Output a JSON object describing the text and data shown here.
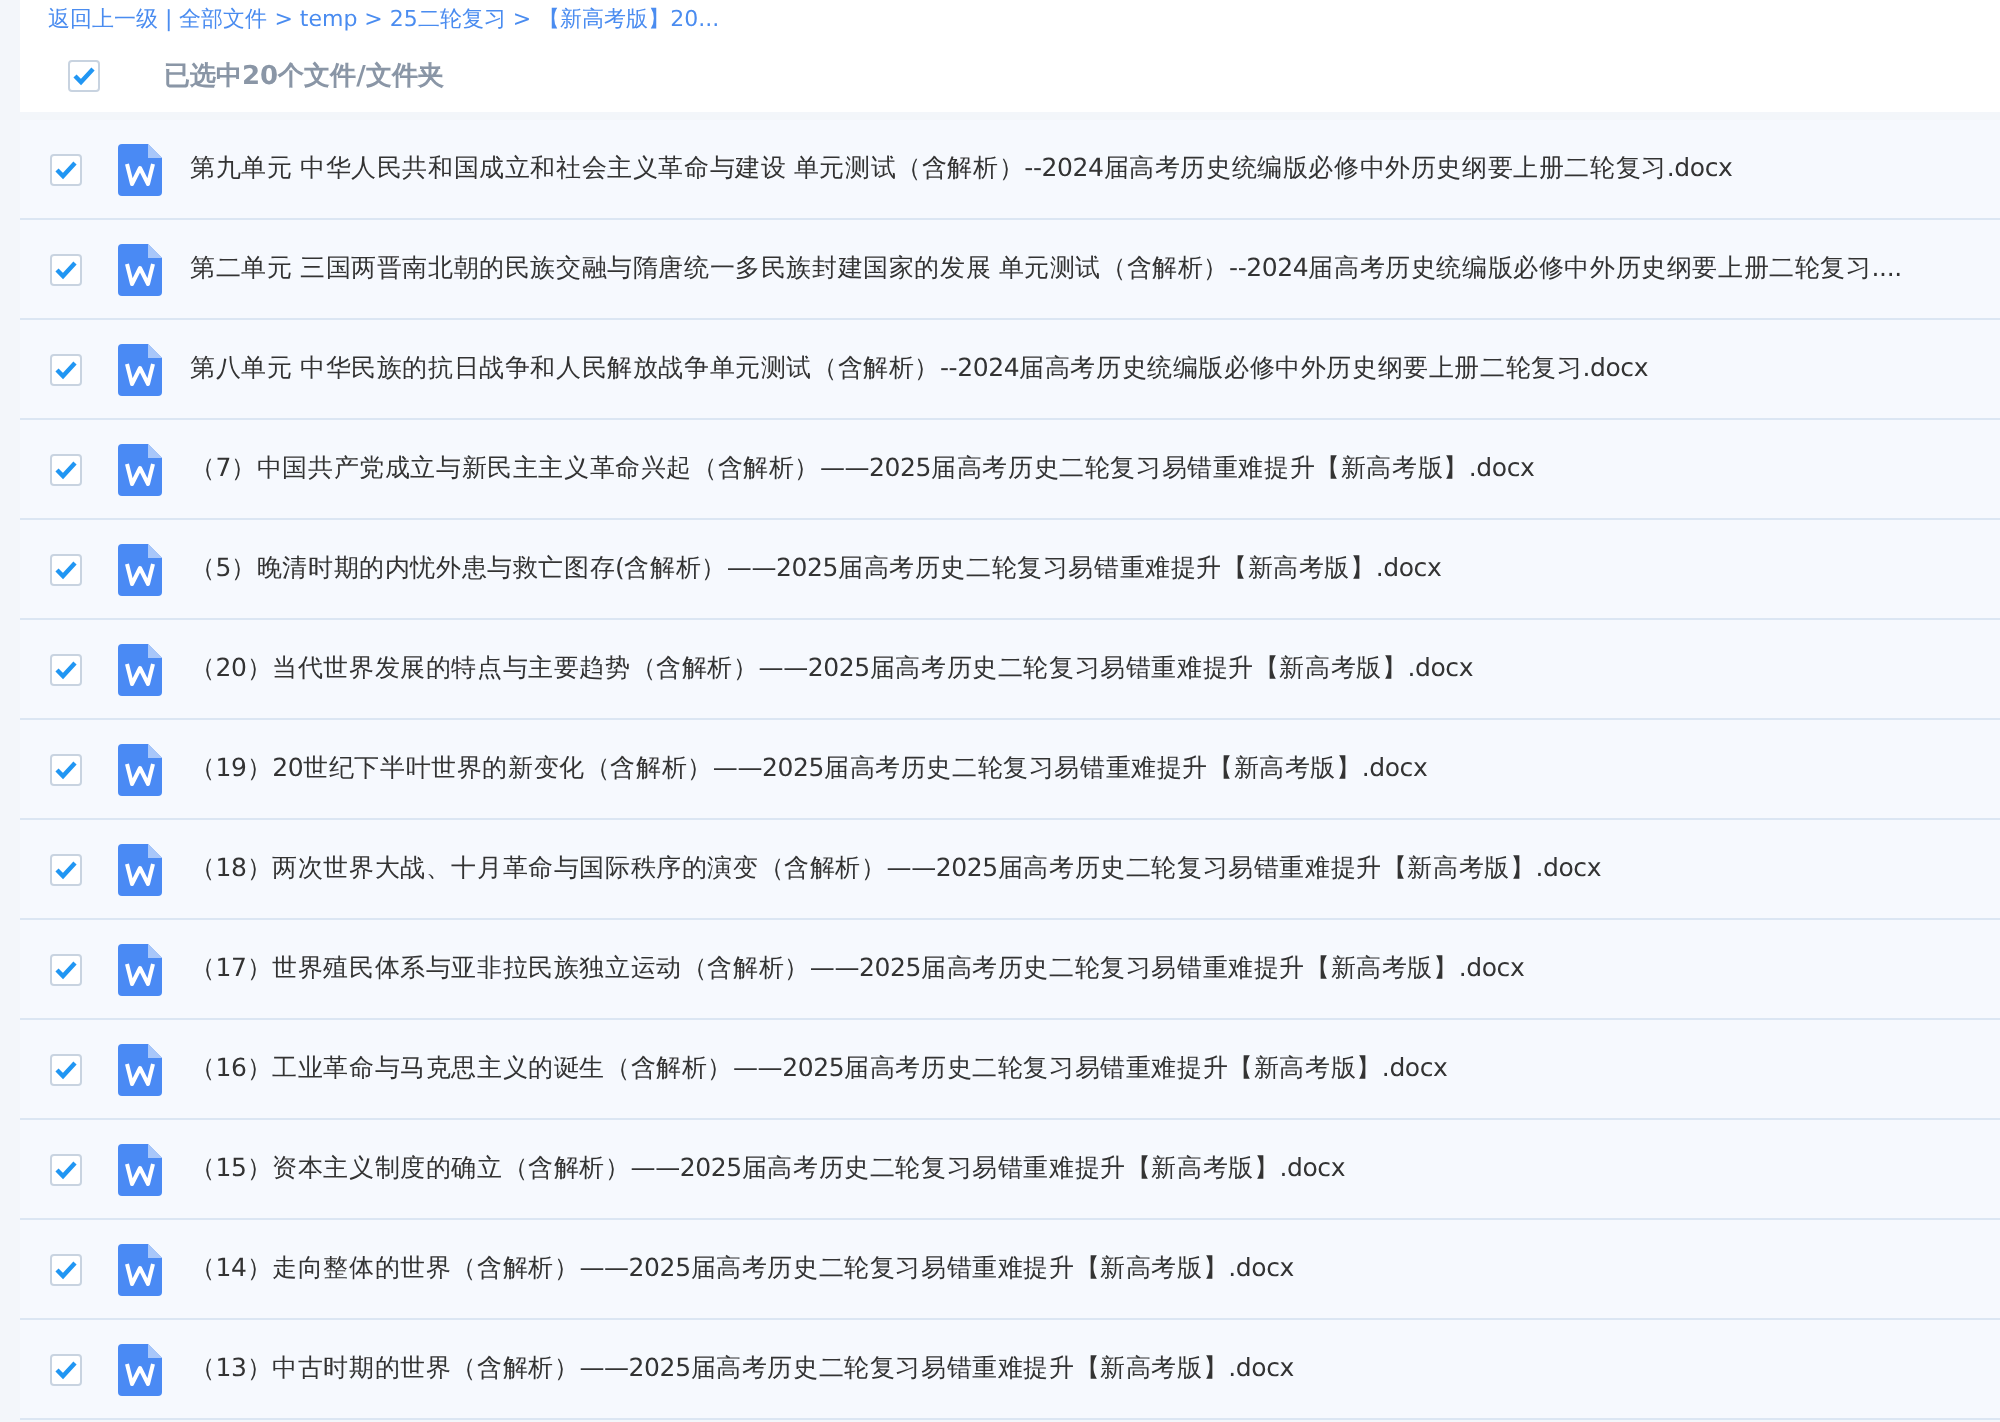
{
  "breadcrumb": {
    "text": "返回上一级 | 全部文件 > temp > 25二轮复习 > 【新高考版】20..."
  },
  "select_all": {
    "checked": true,
    "label": "已选中20个文件/文件夹"
  },
  "files": [
    {
      "name": "第九单元 中华人民共和国成立和社会主义革命与建设 单元测试（含解析）--2024届高考历史统编版必修中外历史纲要上册二轮复习.docx",
      "checked": true
    },
    {
      "name": "第二单元 三国两晋南北朝的民族交融与隋唐统一多民族封建国家的发展 单元测试（含解析）--2024届高考历史统编版必修中外历史纲要上册二轮复习....",
      "checked": true
    },
    {
      "name": "第八单元 中华民族的抗日战争和人民解放战争单元测试（含解析）--2024届高考历史统编版必修中外历史纲要上册二轮复习.docx",
      "checked": true
    },
    {
      "name": "（7）中国共产党成立与新民主主义革命兴起（含解析）——2025届高考历史二轮复习易错重难提升【新高考版】.docx",
      "checked": true
    },
    {
      "name": "（5）晚清时期的内忧外患与救亡图存(含解析）——2025届高考历史二轮复习易错重难提升【新高考版】.docx",
      "checked": true
    },
    {
      "name": "（20）当代世界发展的特点与主要趋势（含解析）——2025届高考历史二轮复习易错重难提升【新高考版】.docx",
      "checked": true
    },
    {
      "name": "（19）20世纪下半叶世界的新变化（含解析）——2025届高考历史二轮复习易错重难提升【新高考版】.docx",
      "checked": true
    },
    {
      "name": "（18）两次世界大战、十月革命与国际秩序的演变（含解析）——2025届高考历史二轮复习易错重难提升【新高考版】.docx",
      "checked": true
    },
    {
      "name": "（17）世界殖民体系与亚非拉民族独立运动（含解析）——2025届高考历史二轮复习易错重难提升【新高考版】.docx",
      "checked": true
    },
    {
      "name": "（16）工业革命与马克思主义的诞生（含解析）——2025届高考历史二轮复习易错重难提升【新高考版】.docx",
      "checked": true
    },
    {
      "name": "（15）资本主义制度的确立（含解析）——2025届高考历史二轮复习易错重难提升【新高考版】.docx",
      "checked": true
    },
    {
      "name": "（14）走向整体的世界（含解析）——2025届高考历史二轮复习易错重难提升【新高考版】.docx",
      "checked": true
    },
    {
      "name": "（13）中古时期的世界（含解析）——2025届高考历史二轮复习易错重难提升【新高考版】.docx",
      "checked": true
    }
  ]
}
